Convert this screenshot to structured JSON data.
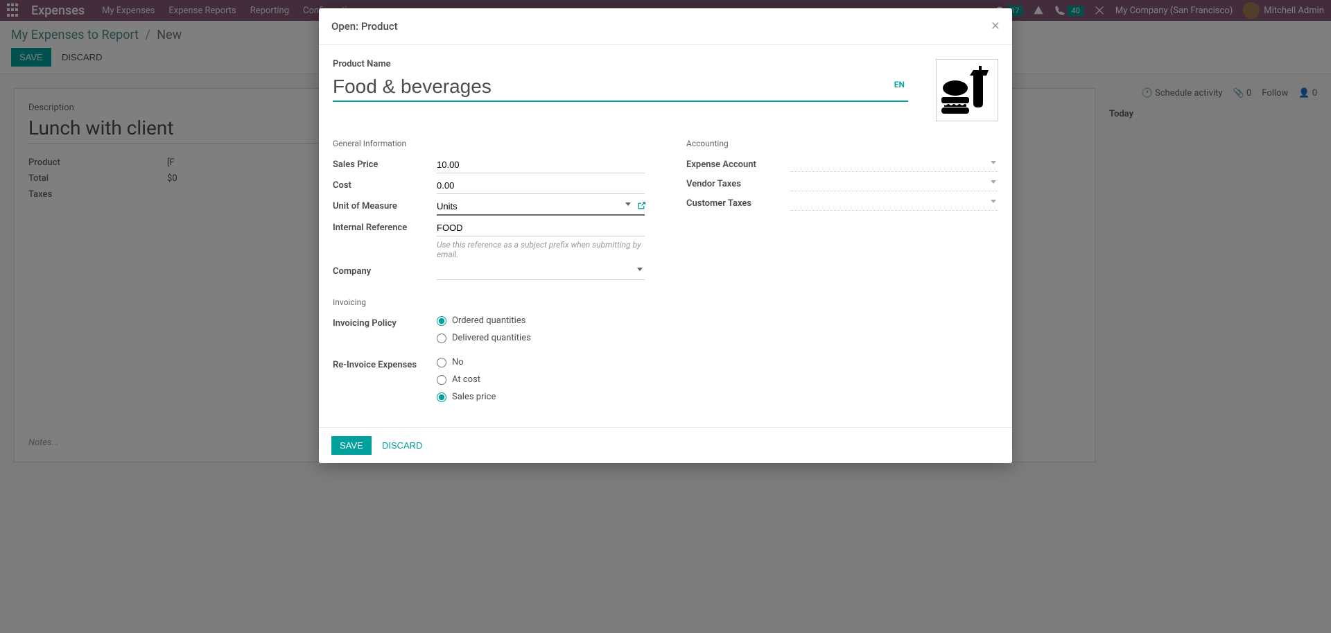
{
  "navbar": {
    "brand": "Expenses",
    "items": [
      "My Expenses",
      "Expense Reports",
      "Reporting",
      "Configuration"
    ],
    "discuss_badge": "17",
    "call_badge": "40",
    "company": "My Company (San Francisco)",
    "user": "Mitchell Admin"
  },
  "control_panel": {
    "breadcrumb_root": "My Expenses to Report",
    "breadcrumb_current": "New",
    "save": "SAVE",
    "discard": "DISCARD"
  },
  "background_form": {
    "desc_label": "Description",
    "desc_value": "Lunch with client",
    "fields": {
      "product_label": "Product",
      "product_value": "[F",
      "total_label": "Total",
      "total_value": "$0",
      "taxes_label": "Taxes"
    },
    "notes_placeholder": "Notes..."
  },
  "right_panel": {
    "schedule": "Schedule activity",
    "attach_count": "0",
    "follow": "Follow",
    "follower_count": "0",
    "today": "Today"
  },
  "modal": {
    "title": "Open: Product",
    "product_name_label": "Product Name",
    "product_name_value": "Food & beverages",
    "lang": "EN",
    "sections": {
      "general": "General Information",
      "accounting": "Accounting",
      "invoicing": "Invoicing"
    },
    "fields": {
      "sales_price": {
        "label": "Sales Price",
        "value": "10.00"
      },
      "cost": {
        "label": "Cost",
        "value": "0.00"
      },
      "uom": {
        "label": "Unit of Measure",
        "value": "Units"
      },
      "internal_ref": {
        "label": "Internal Reference",
        "value": "FOOD",
        "help": "Use this reference as a subject prefix when submitting by email."
      },
      "company": {
        "label": "Company",
        "value": ""
      },
      "expense_account": {
        "label": "Expense Account"
      },
      "vendor_taxes": {
        "label": "Vendor Taxes"
      },
      "customer_taxes": {
        "label": "Customer Taxes"
      },
      "invoicing_policy": {
        "label": "Invoicing Policy",
        "options": [
          "Ordered quantities",
          "Delivered quantities"
        ],
        "selected": 0
      },
      "reinvoice": {
        "label": "Re-Invoice Expenses",
        "options": [
          "No",
          "At cost",
          "Sales price"
        ],
        "selected": 2
      }
    },
    "save": "SAVE",
    "discard": "DISCARD"
  }
}
